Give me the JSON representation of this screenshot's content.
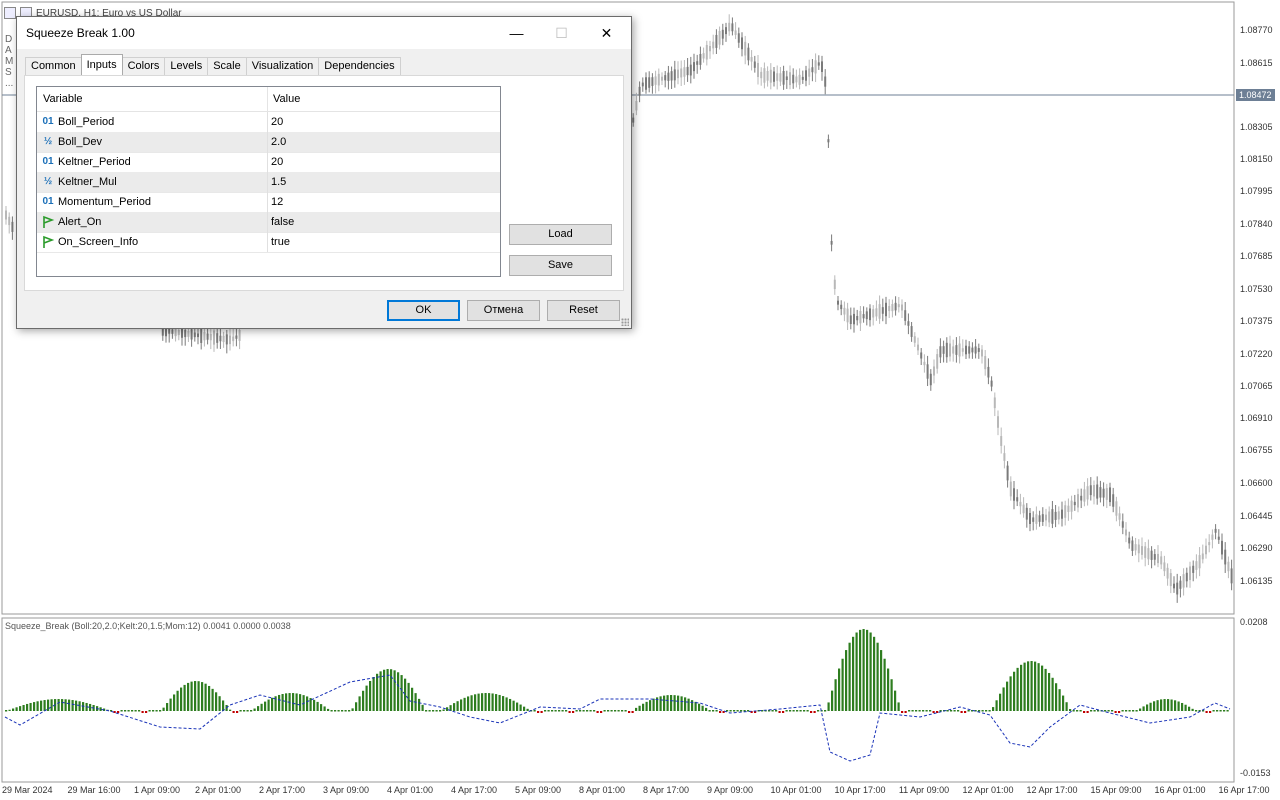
{
  "chart": {
    "window_title": "EURUSD, H1:  Euro vs US Dollar",
    "side_letters": [
      "D",
      "A",
      "M",
      "S",
      "..."
    ],
    "current_price": "1.08472",
    "price_ticks": [
      "1.08770",
      "1.08615",
      "1.08305",
      "1.08150",
      "1.07995",
      "1.07840",
      "1.07685",
      "1.07530",
      "1.07375",
      "1.07220",
      "1.07065",
      "1.06910",
      "1.06755",
      "1.06600",
      "1.06445",
      "1.06290",
      "1.06135"
    ],
    "indicator_label": "Squeeze_Break (Boll:20,2.0;Kelt:20,1.5;Mom:12) 0.0041 0.0000 0.0038",
    "indicator_ticks": [
      "0.0208",
      "-0.0153"
    ],
    "time_ticks": [
      "29 Mar 2024",
      "29 Mar 16:00",
      "1 Apr 09:00",
      "2 Apr 01:00",
      "2 Apr 17:00",
      "3 Apr 09:00",
      "4 Apr 01:00",
      "4 Apr 17:00",
      "5 Apr 09:00",
      "8 Apr 01:00",
      "8 Apr 17:00",
      "9 Apr 09:00",
      "10 Apr 01:00",
      "10 Apr 17:00",
      "11 Apr 09:00",
      "12 Apr 01:00",
      "12 Apr 17:00",
      "15 Apr 09:00",
      "16 Apr 01:00",
      "16 Apr 17:00"
    ],
    "colors": {
      "bull": "#b8b8b8",
      "bear": "#7a7a7a",
      "hist_pos": "#2e7d1f",
      "hist_neg": "#c00000",
      "momentum": "#1a33b8",
      "price_line": "#6d7f95"
    }
  },
  "dialog": {
    "title": "Squeeze Break 1.00",
    "tabs": [
      "Common",
      "Inputs",
      "Colors",
      "Levels",
      "Scale",
      "Visualization",
      "Dependencies"
    ],
    "active_tab": "Inputs",
    "columns": {
      "variable": "Variable",
      "value": "Value"
    },
    "params": [
      {
        "icon": "01",
        "icon_name": "integer-icon",
        "name": "Boll_Period",
        "value": "20"
      },
      {
        "icon": "½",
        "icon_name": "double-icon",
        "name": "Boll_Dev",
        "value": "2.0"
      },
      {
        "icon": "01",
        "icon_name": "integer-icon",
        "name": "Keltner_Period",
        "value": "20"
      },
      {
        "icon": "½",
        "icon_name": "double-icon",
        "name": "Keltner_Mul",
        "value": "1.5"
      },
      {
        "icon": "01",
        "icon_name": "integer-icon",
        "name": "Momentum_Period",
        "value": "12"
      },
      {
        "icon": "flag",
        "icon_name": "bool-icon",
        "name": "Alert_On",
        "value": "false"
      },
      {
        "icon": "flag",
        "icon_name": "bool-icon",
        "name": "On_Screen_Info",
        "value": "true"
      }
    ],
    "load_label": "Load",
    "save_label": "Save",
    "ok_label": "OK",
    "cancel_label": "Отмена",
    "reset_label": "Reset"
  }
}
